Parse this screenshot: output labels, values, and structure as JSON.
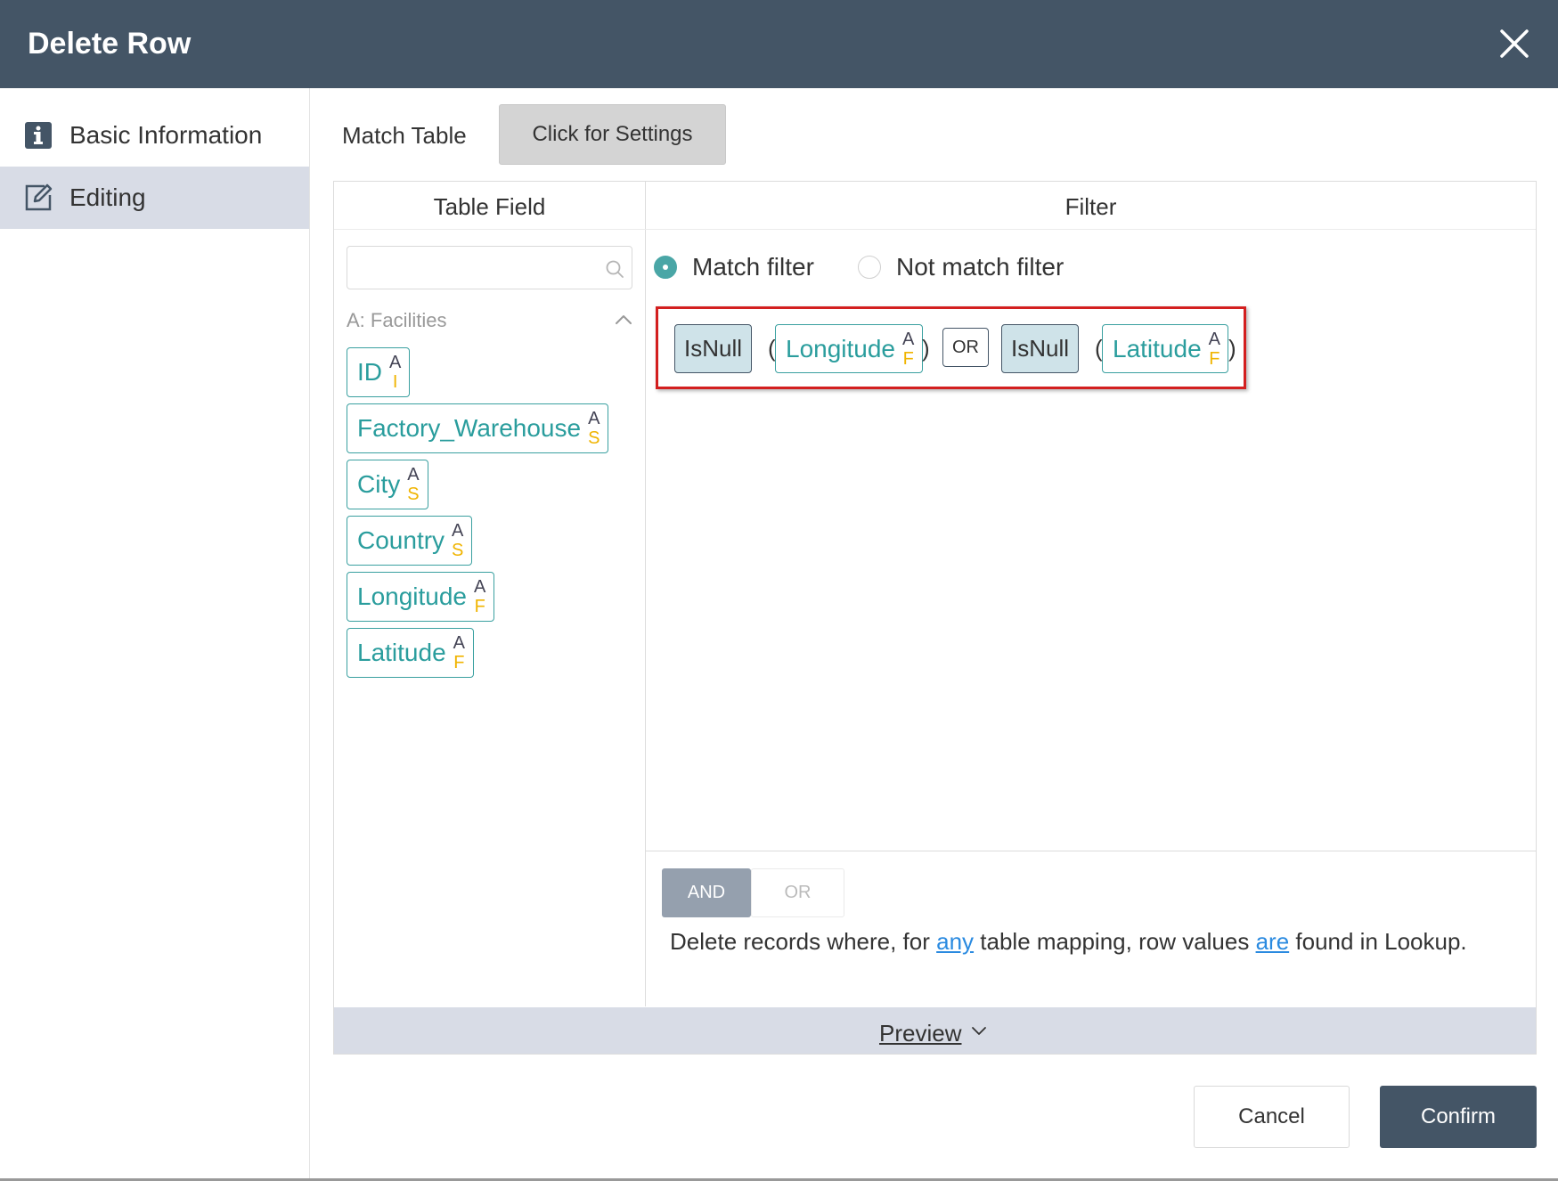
{
  "dialog": {
    "title": "Delete Row"
  },
  "sidebar": {
    "items": [
      {
        "label": "Basic Information",
        "icon": "info-icon",
        "active": false
      },
      {
        "label": "Editing",
        "icon": "edit-icon",
        "active": true
      }
    ]
  },
  "match_table": {
    "label": "Match Table",
    "button_label": "Click for Settings"
  },
  "table_field": {
    "header": "Table Field",
    "search": {
      "value": "",
      "placeholder": ""
    },
    "group_label": "A: Facilities",
    "fields": [
      {
        "name": "ID",
        "source": "A",
        "type": "I"
      },
      {
        "name": "Factory_Warehouse",
        "source": "A",
        "type": "S"
      },
      {
        "name": "City",
        "source": "A",
        "type": "S"
      },
      {
        "name": "Country",
        "source": "A",
        "type": "S"
      },
      {
        "name": "Longitude",
        "source": "A",
        "type": "F"
      },
      {
        "name": "Latitude",
        "source": "A",
        "type": "F"
      }
    ]
  },
  "filter": {
    "header": "Filter",
    "options": [
      {
        "label": "Match filter",
        "selected": true
      },
      {
        "label": "Not match filter",
        "selected": false
      }
    ],
    "expression": {
      "func1": "IsNull",
      "field1": {
        "name": "Longitude",
        "source": "A",
        "type": "F"
      },
      "operator": "OR",
      "func2": "IsNull",
      "field2": {
        "name": "Latitude",
        "source": "A",
        "type": "F"
      },
      "open_paren": "(",
      "close_paren": ")"
    },
    "and_label": "AND",
    "or_label": "OR",
    "description": {
      "prefix": "Delete records where, for ",
      "link1": "any",
      "middle": " table mapping, row values ",
      "link2": "are",
      "suffix": " found in Lookup."
    }
  },
  "preview": {
    "label": "Preview"
  },
  "footer": {
    "cancel": "Cancel",
    "confirm": "Confirm"
  },
  "colors": {
    "header_bg": "#445566",
    "accent_teal": "#2a9d9d",
    "type_yellow": "#f0b400",
    "highlight_red": "#d31f1f",
    "link_blue": "#2a8ae0"
  }
}
